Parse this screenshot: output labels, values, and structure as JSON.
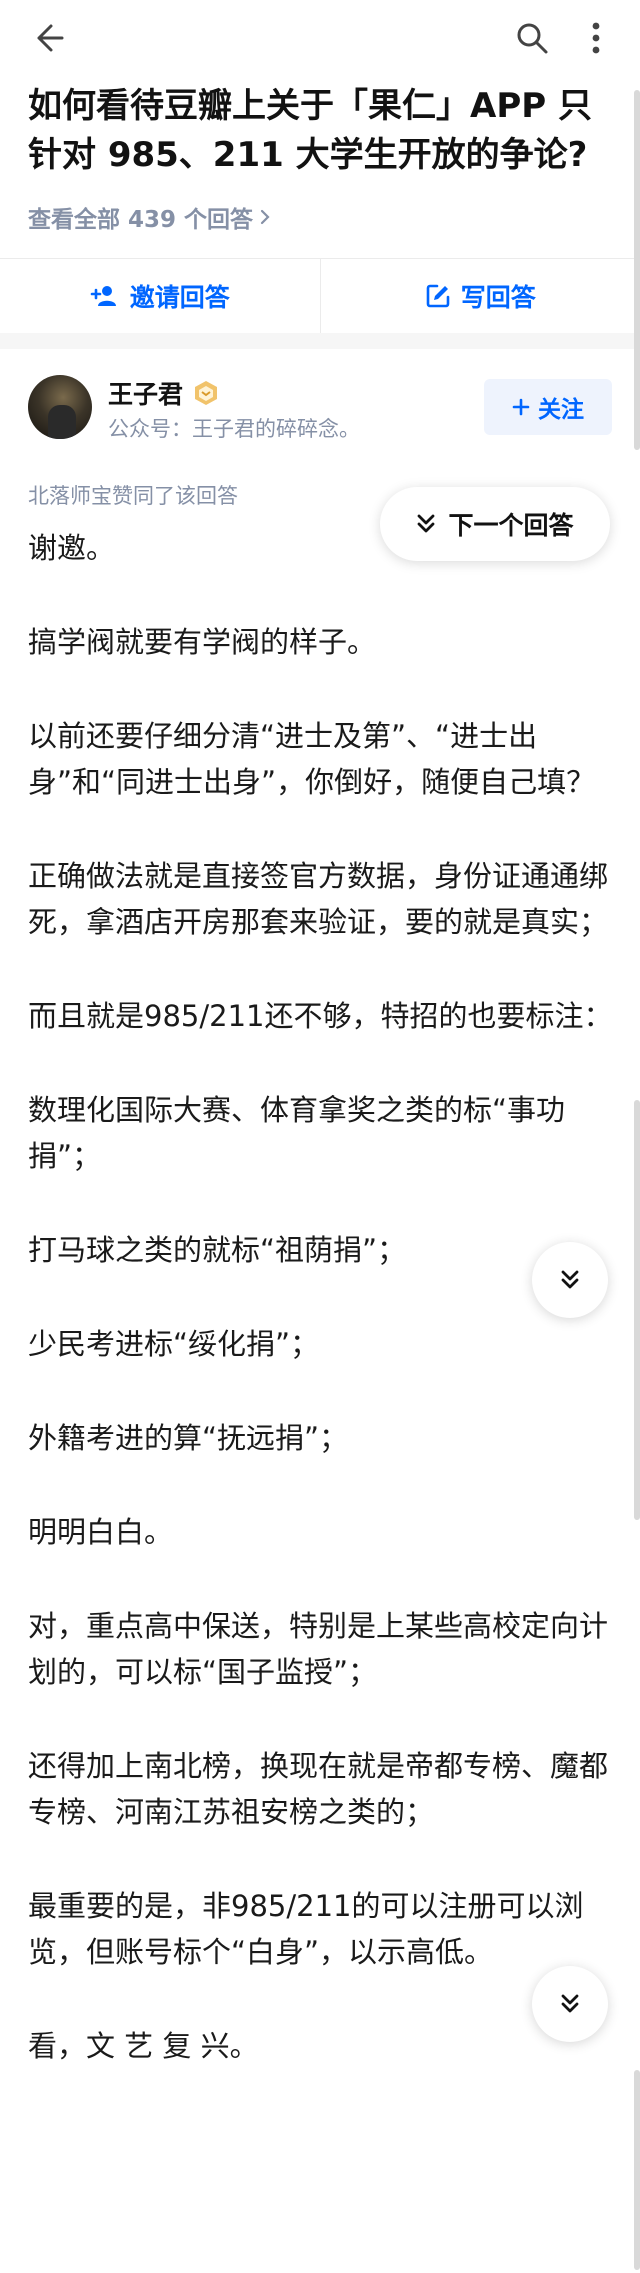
{
  "header": {
    "title": "如何看待豆瓣上关于「果仁」APP 只针对 985、211 大学生开放的争论?",
    "view_all": "查看全部 439 个回答"
  },
  "actions": {
    "invite_label": "邀请回答",
    "write_label": "写回答"
  },
  "author": {
    "name": "王子君",
    "bio": "公众号：王子君的碎碎念。",
    "follow_label": "关注"
  },
  "liked_by": "北落师宝赞同了该回答",
  "next_answer_label": "下一个回答",
  "content": {
    "paragraphs": [
      "谢邀。",
      "搞学阀就要有学阀的样子。",
      "以前还要仔细分清“进士及第”、“进士出身”和“同进士出身”，你倒好，随便自己填？",
      "正确做法就是直接签官方数据，身份证通通绑死，拿酒店开房那套来验证，要的就是真实；",
      "而且就是985/211还不够，特招的也要标注：",
      "数理化国际大赛、体育拿奖之类的标“事功捐”；",
      "打马球之类的就标“祖荫捐”；",
      "少民考进标“绥化捐”；",
      "外籍考进的算“抚远捐”；",
      "明明白白。",
      "对，重点高中保送，特别是上某些高校定向计划的，可以标“国子监授”；",
      "还得加上南北榜，换现在就是帝都专榜、魔都专榜、河南江苏祖安榜之类的；",
      "最重要的是，非985/211的可以注册可以浏览，但账号标个“白身”，以示高低。",
      "看，文 艺 复 兴。"
    ]
  }
}
